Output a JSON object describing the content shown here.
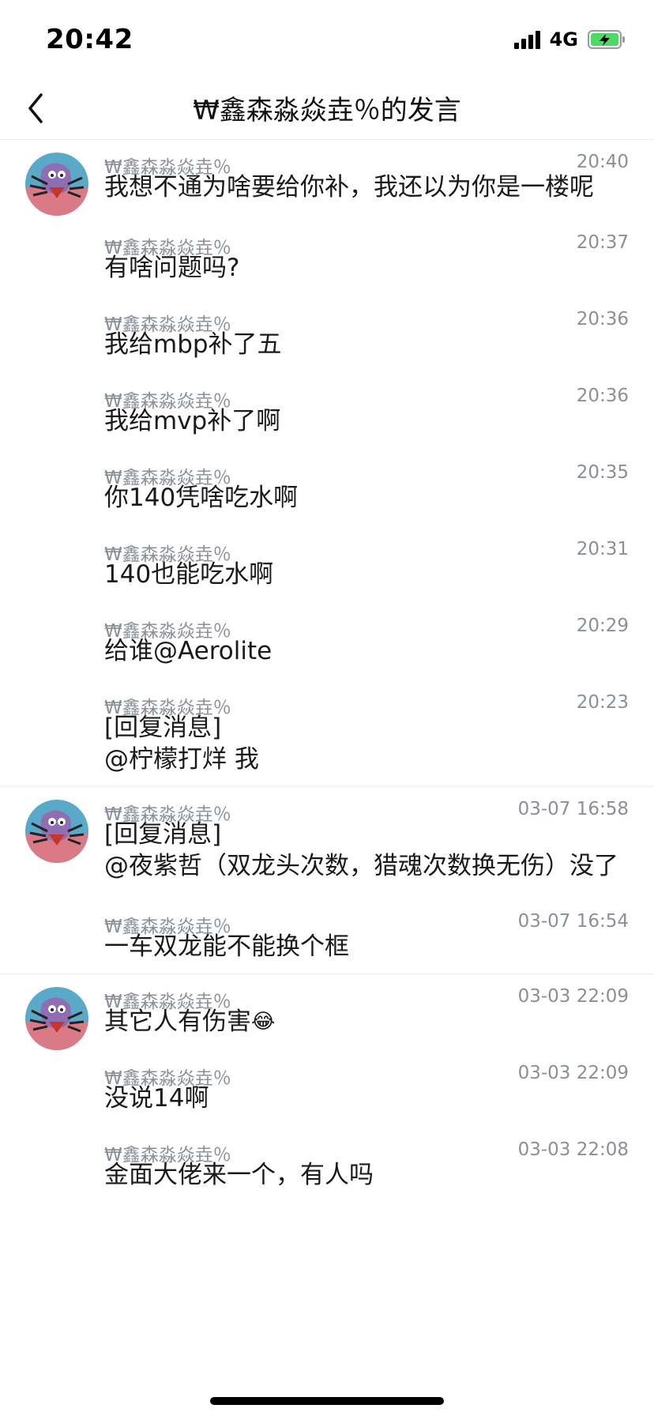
{
  "status_bar": {
    "time": "20:42",
    "network": "4G",
    "battery_color": "#4cd964"
  },
  "header": {
    "title": "₩鑫森淼焱垚％的发言"
  },
  "groups": [
    {
      "messages": [
        {
          "author": "₩鑫森淼焱垚％",
          "time": "20:40",
          "text": "我想不通为啥要给你补，我还以为你是一楼呢"
        },
        {
          "author": "₩鑫森淼焱垚％",
          "time": "20:37",
          "text": "有啥问题吗?"
        },
        {
          "author": "₩鑫森淼焱垚％",
          "time": "20:36",
          "text": "我给mbp补了五"
        },
        {
          "author": "₩鑫森淼焱垚％",
          "time": "20:36",
          "text": "我给mvp补了啊"
        },
        {
          "author": "₩鑫森淼焱垚％",
          "time": "20:35",
          "text": "你140凭啥吃水啊"
        },
        {
          "author": "₩鑫森淼焱垚％",
          "time": "20:31",
          "text": "140也能吃水啊"
        },
        {
          "author": "₩鑫森淼焱垚％",
          "time": "20:29",
          "text": "给谁@Aerolite"
        },
        {
          "author": "₩鑫森淼焱垚％",
          "time": "20:23",
          "text": "[回复消息]\n@柠檬打烊 我"
        }
      ]
    },
    {
      "messages": [
        {
          "author": "₩鑫森淼焱垚％",
          "time": "03-07 16:58",
          "text": "[回复消息]\n@夜紫哲（双龙头次数，猎魂次数换无伤）没了"
        },
        {
          "author": "₩鑫森淼焱垚％",
          "time": "03-07 16:54",
          "text": "一车双龙能不能换个框"
        }
      ]
    },
    {
      "messages": [
        {
          "author": "₩鑫森淼焱垚％",
          "time": "03-03 22:09",
          "text": "其它人有伤害",
          "emoji": "😂"
        },
        {
          "author": "₩鑫森淼焱垚％",
          "time": "03-03 22:09",
          "text": "没说14啊"
        },
        {
          "author": "₩鑫森淼焱垚％",
          "time": "03-03 22:08",
          "text": "金面大佬来一个，有人吗"
        }
      ]
    }
  ]
}
